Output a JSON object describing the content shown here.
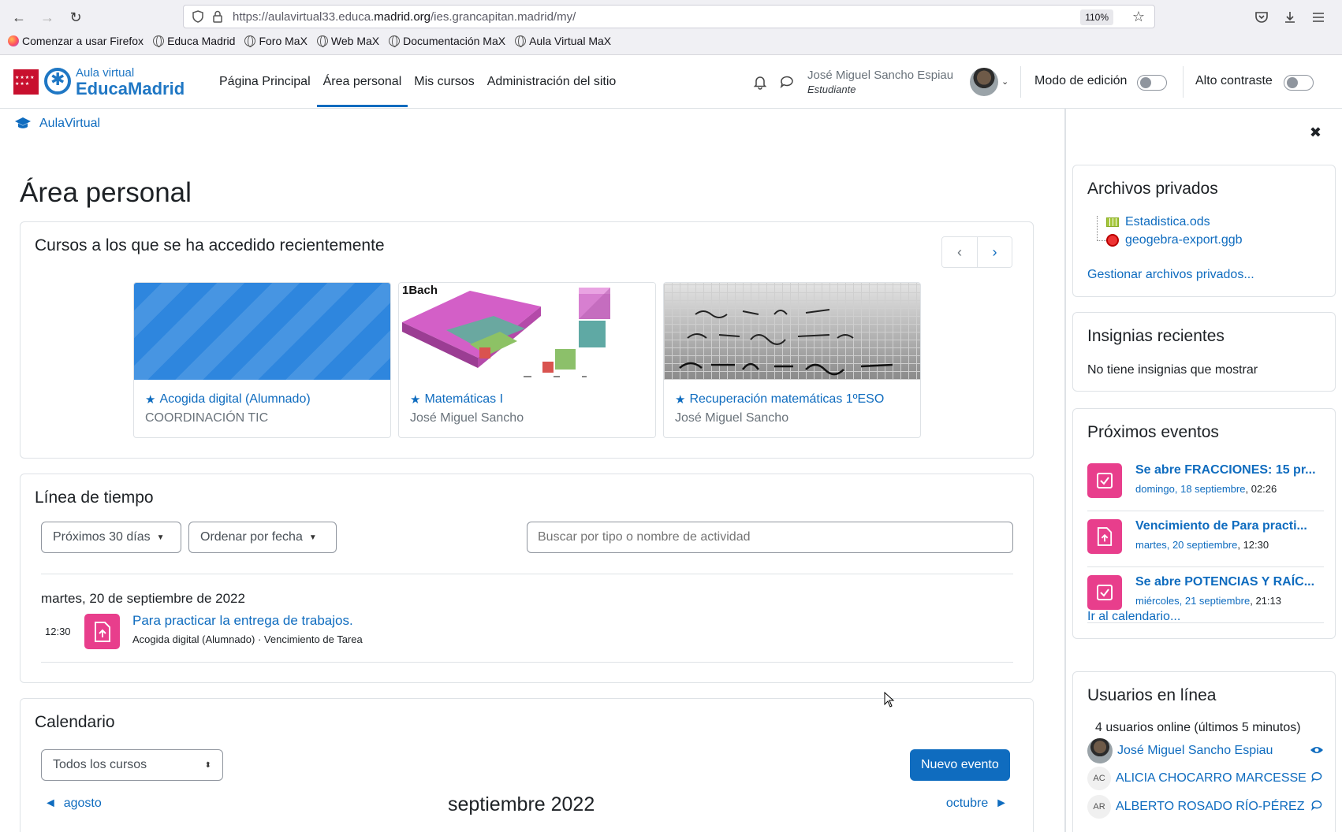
{
  "browser": {
    "url_prefix": "https://aulavirtual33.educa.",
    "url_domain": "madrid.org",
    "url_suffix": "/ies.grancapitan.madrid/my/",
    "zoom": "110%",
    "bookmarks": [
      "Comenzar a usar Firefox",
      "Educa Madrid",
      "Foro MaX",
      "Web MaX",
      "Documentación MaX",
      "Aula Virtual MaX"
    ]
  },
  "header": {
    "logo_sub": "Aula virtual",
    "logo_main": "EducaMadrid",
    "nav": [
      "Página Principal",
      "Área personal",
      "Mis cursos",
      "Administración del sitio"
    ],
    "user_name": "José Miguel Sancho Espiau",
    "user_role": "Estudiante",
    "edit_mode_label": "Modo de edición",
    "high_contrast_label": "Alto contraste"
  },
  "breadcrumb": "AulaVirtual",
  "page_title": "Área personal",
  "recent_courses": {
    "title": "Cursos a los que se ha accedido recientemente",
    "courses": [
      {
        "name": "Acogida digital (Alumnado)",
        "teacher": "COORDINACIÓN TIC"
      },
      {
        "name": "Matemáticas I",
        "teacher": "José Miguel Sancho",
        "image_label": "1Bach"
      },
      {
        "name": "Recuperación matemáticas 1ºESO",
        "teacher": "José Miguel Sancho"
      }
    ]
  },
  "timeline": {
    "title": "Línea de tiempo",
    "filter_label": "Próximos 30 días",
    "sort_label": "Ordenar por fecha",
    "search_placeholder": "Buscar por tipo o nombre de actividad",
    "date": "martes, 20 de septiembre de 2022",
    "event_time": "12:30",
    "event_title": "Para practicar la entrega de trabajos.",
    "event_sub": "Acogida digital (Alumnado) · Vencimiento de Tarea"
  },
  "calendar": {
    "title": "Calendario",
    "course_filter": "Todos los cursos",
    "new_event": "Nuevo evento",
    "prev_month": "agosto",
    "next_month": "octubre",
    "current_month": "septiembre 2022"
  },
  "drawer": {
    "private_files": {
      "title": "Archivos privados",
      "files": [
        "Estadistica.ods",
        "geogebra-export.ggb"
      ],
      "manage_link": "Gestionar archivos privados..."
    },
    "badges": {
      "title": "Insignias recientes",
      "empty": "No tiene insignias que mostrar"
    },
    "events": {
      "title": "Próximos eventos",
      "items": [
        {
          "title": "Se abre FRACCIONES: 15 pr...",
          "date_link": "domingo, 18 septiembre",
          "time": ", 02:26"
        },
        {
          "title": "Vencimiento de Para practi...",
          "date_link": "martes, 20 septiembre",
          "time": ", 12:30"
        },
        {
          "title": "Se abre POTENCIAS Y RAÍC...",
          "date_link": "miércoles, 21 septiembre",
          "time": ", 21:13"
        }
      ],
      "calendar_link": "Ir al calendario..."
    },
    "online": {
      "title": "Usuarios en línea",
      "summary": "4 usuarios online (últimos 5 minutos)",
      "users": [
        {
          "initials": "",
          "name": "José Miguel Sancho Espiau"
        },
        {
          "initials": "AC",
          "name": "ALICIA CHOCARRO MARCESSE"
        },
        {
          "initials": "AR",
          "name": "ALBERTO ROSADO RÍO-PÉREZ"
        }
      ]
    }
  },
  "colors": {
    "brand_blue": "#0f6cbf",
    "event_pink": "#e83e8c",
    "madrid_red": "#c8102e"
  }
}
